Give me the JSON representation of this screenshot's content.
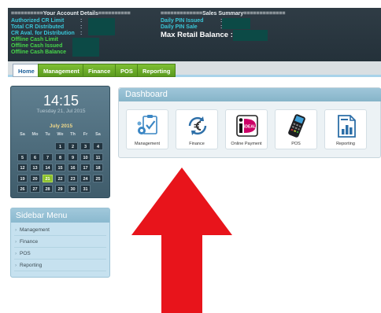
{
  "header": {
    "account_title": "==========Your Account Details==========",
    "sales_title": "=============Sales Summary=============",
    "account_fields": [
      {
        "label": "Authorized CR Limit"
      },
      {
        "label": "Total CR Distributed"
      },
      {
        "label": "CR Aval. for Distribution"
      },
      {
        "label": "Offline Cash Limit"
      },
      {
        "label": "Offline Cash Issued"
      },
      {
        "label": "Offline Cash Balance"
      }
    ],
    "sales_fields": [
      {
        "label": "Daily PIN Issued"
      },
      {
        "label": "Daily PIN Sale"
      }
    ],
    "max_retail_label": "Max Retail Balance",
    "colon": ":"
  },
  "nav": {
    "tabs": [
      {
        "label": "Home",
        "active": true
      },
      {
        "label": "Management"
      },
      {
        "label": "Finance"
      },
      {
        "label": "POS"
      },
      {
        "label": "Reporting"
      }
    ]
  },
  "calendar": {
    "time": "14:15",
    "date": "Tuesday 21, Jul 2015",
    "month": "July 2015",
    "dow": [
      "Sa",
      "Mo",
      "Tu",
      "We",
      "Th",
      "Fr",
      "Sa"
    ],
    "today": "21",
    "weeks": [
      [
        "",
        "",
        "",
        "1",
        "2",
        "3",
        "4"
      ],
      [
        "5",
        "6",
        "7",
        "8",
        "9",
        "10",
        "11"
      ],
      [
        "12",
        "13",
        "14",
        "15",
        "16",
        "17",
        "18"
      ],
      [
        "19",
        "20",
        "21",
        "22",
        "23",
        "24",
        "25"
      ],
      [
        "26",
        "27",
        "28",
        "29",
        "30",
        "31",
        ""
      ]
    ]
  },
  "sidebar": {
    "title": "Sidebar Menu",
    "items": [
      {
        "label": "Management"
      },
      {
        "label": "Finance"
      },
      {
        "label": "POS"
      },
      {
        "label": "Reporting"
      }
    ]
  },
  "dashboard": {
    "title": "Dashboard",
    "tiles": [
      {
        "label": "Management",
        "icon": "management-icon"
      },
      {
        "label": "Finance",
        "icon": "finance-euro-icon"
      },
      {
        "label": "Online Payment",
        "icon": "ideal-icon"
      },
      {
        "label": "POS",
        "icon": "pos-terminal-icon"
      },
      {
        "label": "Reporting",
        "icon": "report-chart-icon"
      }
    ],
    "ideal_logo_text": "iDEAL"
  },
  "colors": {
    "header_bg": "#2f3c45",
    "nav_green": "#6aad27",
    "cyan_text": "#39c6d8",
    "green_text": "#47d64a",
    "arrow_red": "#e8141b",
    "panel_blue": "#9fc6d9"
  }
}
